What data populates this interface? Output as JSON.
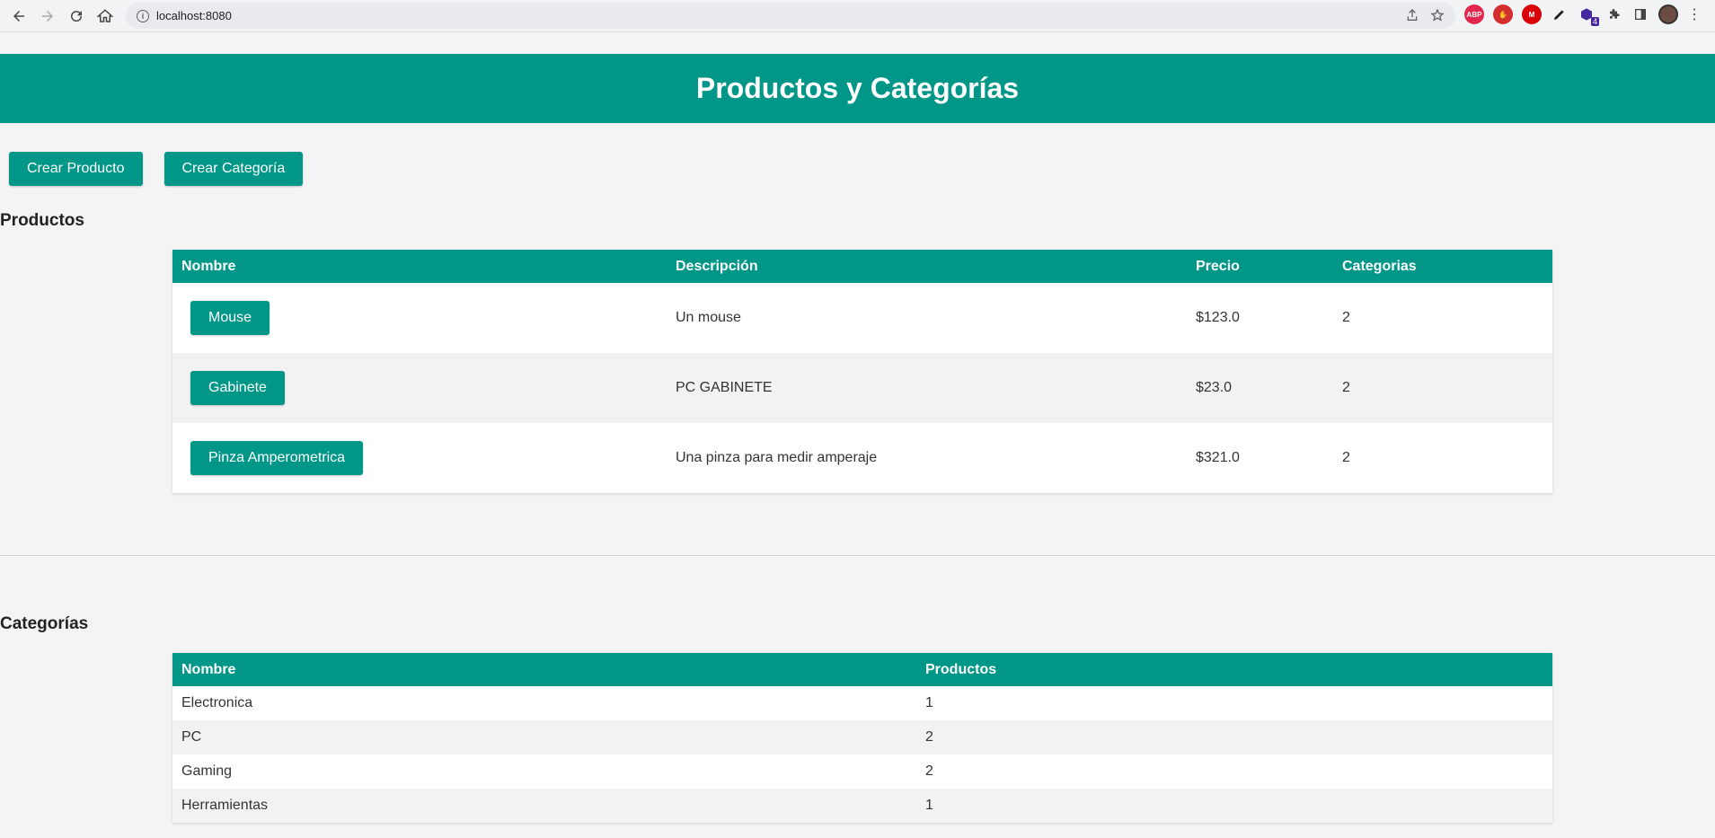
{
  "browser": {
    "url": "localhost:8080",
    "ext_abp": "ABP",
    "ext_badge": "4"
  },
  "page": {
    "title": "Productos y Categorías",
    "actions": {
      "create_product": "Crear Producto",
      "create_category": "Crear Categoría"
    }
  },
  "products": {
    "heading": "Productos",
    "columns": [
      "Nombre",
      "Descripción",
      "Precio",
      "Categorias"
    ],
    "rows": [
      {
        "name": "Mouse",
        "description": "Un mouse",
        "price": "$123.0",
        "categories": "2"
      },
      {
        "name": "Gabinete",
        "description": "PC GABINETE",
        "price": "$23.0",
        "categories": "2"
      },
      {
        "name": "Pinza Amperometrica",
        "description": "Una pinza para medir amperaje",
        "price": "$321.0",
        "categories": "2"
      }
    ]
  },
  "categories": {
    "heading": "Categorías",
    "columns": [
      "Nombre",
      "Productos"
    ],
    "rows": [
      {
        "name": "Electronica",
        "products": "1"
      },
      {
        "name": "PC",
        "products": "2"
      },
      {
        "name": "Gaming",
        "products": "2"
      },
      {
        "name": "Herramientas",
        "products": "1"
      }
    ]
  },
  "colors": {
    "accent": "#009688",
    "background": "#f4f4f4"
  }
}
